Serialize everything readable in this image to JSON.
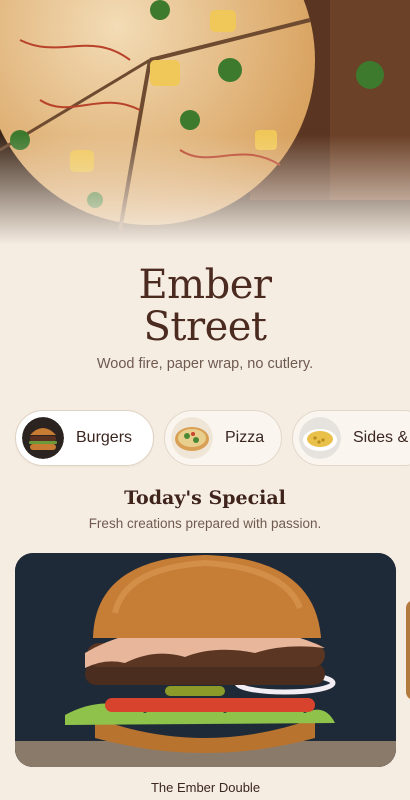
{
  "restaurant": {
    "name_line1": "Ember",
    "name_line2": "Street",
    "tagline": "Wood fire, paper wrap, no cutlery."
  },
  "categories": [
    {
      "label": "Burgers",
      "icon": "burger-icon",
      "active": true
    },
    {
      "label": "Pizza",
      "icon": "pizza-icon",
      "active": false
    },
    {
      "label": "Sides &",
      "icon": "sides-icon",
      "active": false
    }
  ],
  "special": {
    "title": "Today's Special",
    "subtitle": "Fresh creations prepared with passion.",
    "items": [
      {
        "name": "The Ember Double"
      }
    ]
  },
  "colors": {
    "background": "#f6ede2",
    "title": "#4b2a20",
    "chip_bg": "#faf5ef",
    "chip_border": "#e2d7ca"
  }
}
